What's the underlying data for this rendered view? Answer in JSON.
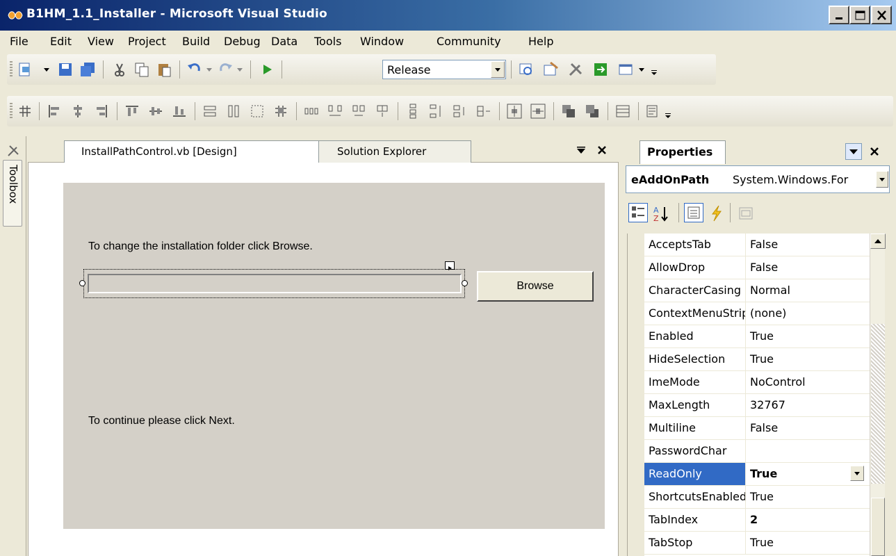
{
  "window": {
    "title": "B1HM_1.1_Installer - Microsoft Visual Studio"
  },
  "menu": [
    "File",
    "Edit",
    "View",
    "Project",
    "Build",
    "Debug",
    "Data",
    "Tools",
    "Window",
    "Community",
    "Help"
  ],
  "toolbar": {
    "configuration": "Release"
  },
  "toolbox": {
    "label": "Toolbox"
  },
  "tabs": {
    "active": "InstallPathControl.vb [Design]",
    "inactive": "Solution Explorer"
  },
  "designer": {
    "label_change": "To change the installation folder click Browse.",
    "label_continue": "To continue please click Next.",
    "browse_button": "Browse"
  },
  "properties": {
    "title": "Properties",
    "object_name": "eAddOnPath",
    "object_type": "System.Windows.For",
    "rows": [
      {
        "name": "AcceptsTab",
        "value": "False"
      },
      {
        "name": "AllowDrop",
        "value": "False"
      },
      {
        "name": "CharacterCasing",
        "value": "Normal"
      },
      {
        "name": "ContextMenuStrip",
        "value": "(none)"
      },
      {
        "name": "Enabled",
        "value": "True"
      },
      {
        "name": "HideSelection",
        "value": "True"
      },
      {
        "name": "ImeMode",
        "value": "NoControl"
      },
      {
        "name": "MaxLength",
        "value": "32767"
      },
      {
        "name": "Multiline",
        "value": "False"
      },
      {
        "name": "PasswordChar",
        "value": ""
      },
      {
        "name": "ReadOnly",
        "value": "True"
      },
      {
        "name": "ShortcutsEnabled",
        "value": "True"
      },
      {
        "name": "TabIndex",
        "value": "2"
      },
      {
        "name": "TabStop",
        "value": "True"
      }
    ]
  }
}
